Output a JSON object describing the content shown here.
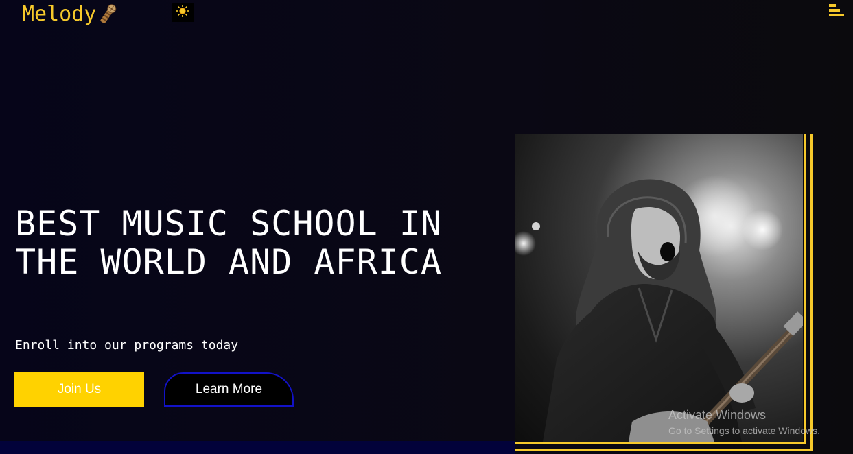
{
  "nav": {
    "brand": "Melody",
    "brand_icon": "microphone-icon",
    "theme_icon": "sun-icon",
    "menu_icon": "hamburger-menu-icon"
  },
  "hero": {
    "title": "BEST MUSIC SCHOOL IN THE WORLD AND AFRICA",
    "subtitle": "Enroll into our programs today",
    "join_label": "Join Us",
    "learn_label": "Learn More",
    "image_alt": "Guitarist singing passionately on stage"
  },
  "watermark": {
    "title": "Activate Windows",
    "subtitle": "Go to Settings to activate Windows."
  },
  "colors": {
    "accent": "#ffd200",
    "brand_yellow": "#f6c92b",
    "background": "#07051a",
    "outline_blue": "#1212c8"
  }
}
